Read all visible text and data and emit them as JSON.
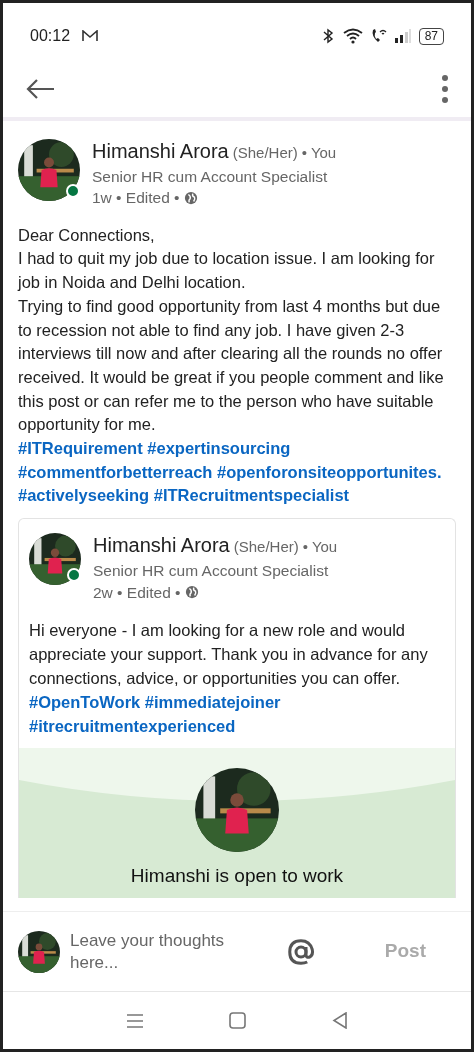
{
  "status_bar": {
    "time": "00:12",
    "battery": "87"
  },
  "post": {
    "author": {
      "name": "Himanshi Arora",
      "pronouns": "(She/Her)",
      "relation": "• You",
      "headline": "Senior HR cum Account Specialist",
      "meta": "1w • Edited •",
      "online": true
    },
    "body": "Dear Connections,\nI had to quit my job due to location issue. I am looking for job in Noida and Delhi location.\nTrying to find  good opportunity from last 4 months but due to recession not able to find any job. I have given 2-3 interviews till now and after clearing all the rounds no offer received. It would be great if you people comment and like this post or can refer me to the person who have suitable opportunity for me.\n**#ITRequirement #expertinsourcing #commentforbetterreach #openforonsiteopportunites. #activelyseeking #ITRecruitmentspecialist**",
    "shared_post": {
      "author": {
        "name": "Himanshi Arora",
        "pronouns": "(She/Her)",
        "relation": "• You",
        "headline": "Senior HR cum Account Specialist",
        "meta": "2w • Edited •",
        "online": true
      },
      "body": "Hi everyone - I am looking for a new role and would appreciate your support. Thank you in advance for any connections, advice, or opportunities you can offer. **#OpenToWork #immediatejoiner #itrecruitmentexperienced**",
      "open_to_work_card": {
        "title": "Himanshi is open to work"
      }
    }
  },
  "comment_bar": {
    "placeholder": "Leave your thoughts here...",
    "post_button": "Post",
    "post_disabled": true
  }
}
